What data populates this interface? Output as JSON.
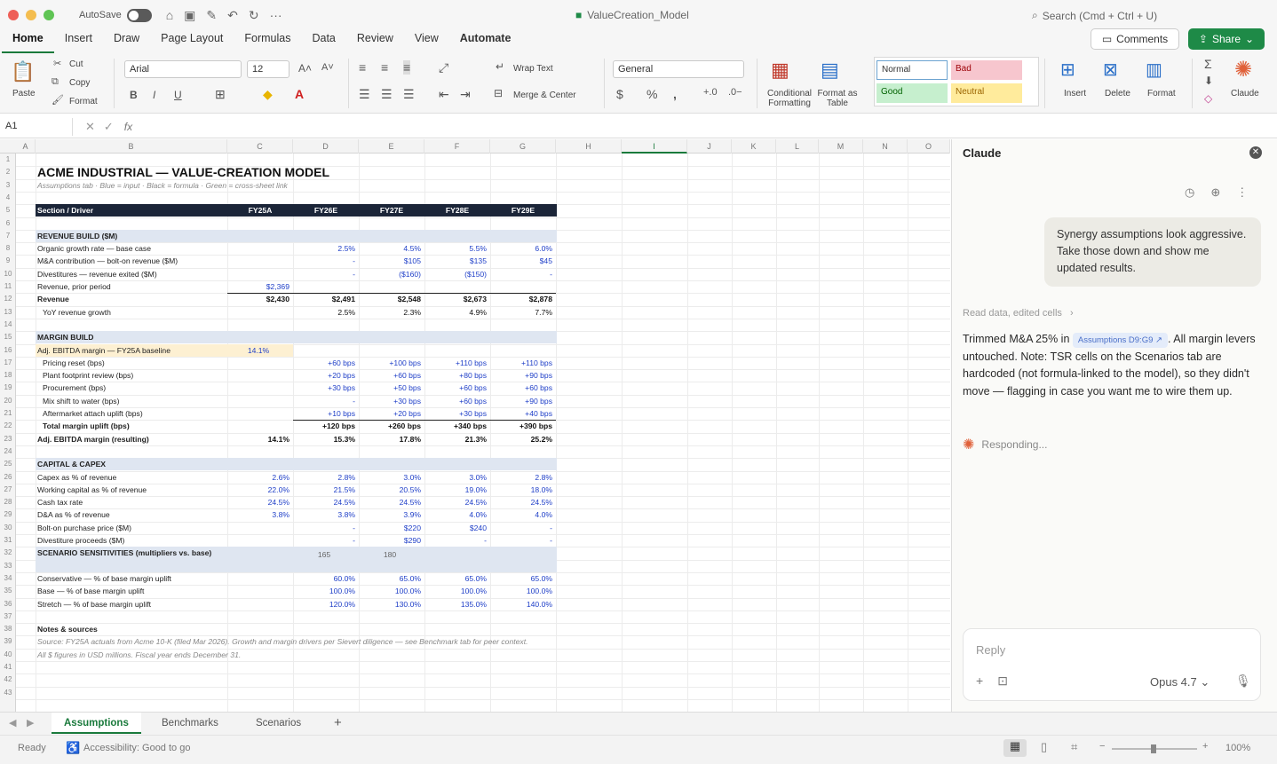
{
  "window": {
    "autosave_label": "AutoSave",
    "title": "ValueCreation_Model",
    "search_placeholder": "Search (Cmd + Ctrl + U)"
  },
  "menu": {
    "tabs": [
      "Home",
      "Insert",
      "Draw",
      "Page Layout",
      "Formulas",
      "Data",
      "Review",
      "View",
      "Automate"
    ],
    "comments_label": "Comments",
    "share_label": "Share"
  },
  "ribbon": {
    "paste": "Paste",
    "cut": "Cut",
    "copy": "Copy",
    "format_painter": "Format",
    "font_name": "Arial",
    "font_size": "12",
    "wrap_text": "Wrap Text",
    "merge_center": "Merge & Center",
    "number_format": "General",
    "conditional_formatting": "Conditional Formatting",
    "format_as_table": "Format as Table",
    "styles": {
      "normal": "Normal",
      "bad": "Bad",
      "good": "Good",
      "neutral": "Neutral"
    },
    "insert": "Insert",
    "delete": "Delete",
    "format": "Format",
    "claude": "Claude"
  },
  "formula_bar": {
    "name_box": "A1",
    "fx": "fx"
  },
  "columns": [
    "A",
    "B",
    "C",
    "D",
    "E",
    "F",
    "G",
    "H",
    "I",
    "J",
    "K",
    "L",
    "M",
    "N",
    "O"
  ],
  "sheet": {
    "title": "ACME INDUSTRIAL — VALUE-CREATION MODEL",
    "subtitle": "Assumptions tab  ·  Blue = input  ·  Black = formula  ·  Green = cross-sheet link",
    "header": [
      "Section / Driver",
      "FY25A",
      "FY26E",
      "FY27E",
      "FY28E",
      "FY29E"
    ],
    "rows": {
      "r7": [
        "REVENUE BUILD ($M)"
      ],
      "r8": [
        "Organic growth rate — base case",
        "",
        "2.5%",
        "4.5%",
        "5.5%",
        "6.0%"
      ],
      "r9": [
        "M&A contribution — bolt-on revenue ($M)",
        "",
        "-",
        "$105",
        "$135",
        "$45"
      ],
      "r10": [
        "Divestitures — revenue exited ($M)",
        "",
        "-",
        "($160)",
        "($150)",
        "-"
      ],
      "r11": [
        "Revenue, prior period",
        "$2,369",
        "",
        "",
        "",
        ""
      ],
      "r12": [
        "Revenue",
        "$2,430",
        "$2,491",
        "$2,548",
        "$2,673",
        "$2,878"
      ],
      "r13": [
        "YoY revenue growth",
        "",
        "2.5%",
        "2.3%",
        "4.9%",
        "7.7%"
      ],
      "r15": [
        "MARGIN BUILD"
      ],
      "r16": [
        "Adj. EBITDA margin — FY25A baseline",
        "14.1%",
        "",
        "",
        "",
        ""
      ],
      "r17": [
        "Pricing reset (bps)",
        "",
        "+60 bps",
        "+100 bps",
        "+110 bps",
        "+110 bps"
      ],
      "r18": [
        "Plant footprint review (bps)",
        "",
        "+20 bps",
        "+60 bps",
        "+80 bps",
        "+90 bps"
      ],
      "r19": [
        "Procurement (bps)",
        "",
        "+30 bps",
        "+50 bps",
        "+60 bps",
        "+60 bps"
      ],
      "r20": [
        "Mix shift to water (bps)",
        "",
        "-",
        "+30 bps",
        "+60 bps",
        "+90 bps"
      ],
      "r21": [
        "Aftermarket attach uplift (bps)",
        "",
        "+10 bps",
        "+20 bps",
        "+30 bps",
        "+40 bps"
      ],
      "r22": [
        "Total margin uplift (bps)",
        "",
        "+120 bps",
        "+260 bps",
        "+340 bps",
        "+390 bps"
      ],
      "r23": [
        "Adj. EBITDA margin (resulting)",
        "14.1%",
        "15.3%",
        "17.8%",
        "21.3%",
        "25.2%"
      ],
      "r25": [
        "CAPITAL & CAPEX"
      ],
      "r26": [
        "Capex as % of revenue",
        "2.6%",
        "2.8%",
        "3.0%",
        "3.0%",
        "2.8%"
      ],
      "r27": [
        "Working capital as % of revenue",
        "22.0%",
        "21.5%",
        "20.5%",
        "19.0%",
        "18.0%"
      ],
      "r28": [
        "Cash tax rate",
        "24.5%",
        "24.5%",
        "24.5%",
        "24.5%",
        "24.5%"
      ],
      "r29": [
        "D&A as % of revenue",
        "3.8%",
        "3.8%",
        "3.9%",
        "4.0%",
        "4.0%"
      ],
      "r30": [
        "Bolt-on purchase price ($M)",
        "",
        "-",
        "$220",
        "$240",
        "-"
      ],
      "r31": [
        "Divestiture proceeds ($M)",
        "",
        "-",
        "$290",
        "-",
        "-"
      ],
      "r33": [
        "SCENARIO SENSITIVITIES (multipliers vs. base)",
        "",
        "165",
        "180",
        "",
        ""
      ],
      "r34": [
        "Conservative — % of base margin uplift",
        "",
        "60.0%",
        "65.0%",
        "65.0%",
        "65.0%"
      ],
      "r35": [
        "Base — % of base margin uplift",
        "",
        "100.0%",
        "100.0%",
        "100.0%",
        "100.0%"
      ],
      "r36": [
        "Stretch — % of base margin uplift",
        "",
        "120.0%",
        "130.0%",
        "135.0%",
        "140.0%"
      ],
      "r38": [
        "Notes & sources"
      ],
      "r39": [
        "Source: FY25A actuals from Acme 10-K (filed Mar 2026). Growth and margin drivers per Sievert diligence — see Benchmark tab for peer context."
      ],
      "r40": [
        "All $ figures in USD millions. Fiscal year ends December 31."
      ]
    }
  },
  "sheet_tabs": [
    "Assumptions",
    "Benchmarks",
    "Scenarios",
    "+"
  ],
  "status": {
    "ready": "Ready",
    "accessibility": "Accessibility: Good to go",
    "zoom": "100%"
  },
  "claude": {
    "title": "Claude",
    "user_message": "Synergy assumptions look aggressive. Take those down and show me updated results.",
    "read_data": "Read data, edited cells",
    "reply_before_chip": "Trimmed M&A 25% in",
    "chip": "Assumptions D9:G9 ↗",
    "reply_after_chip": ". All margin levers untouched. Note: TSR cells on the Scenarios tab are hardcoded (not formula-linked to the model), so they didn't move — flagging in case you want me to wire them up.",
    "responding": "Responding...",
    "reply_placeholder": "Reply",
    "model": "Opus 4.7"
  },
  "colors": {
    "accent_green": "#1e8a47",
    "input_blue": "#1f3fc8",
    "header_navy": "#1b2538",
    "section_fill": "#dfe6f1",
    "claude_orange": "#e0613a"
  }
}
